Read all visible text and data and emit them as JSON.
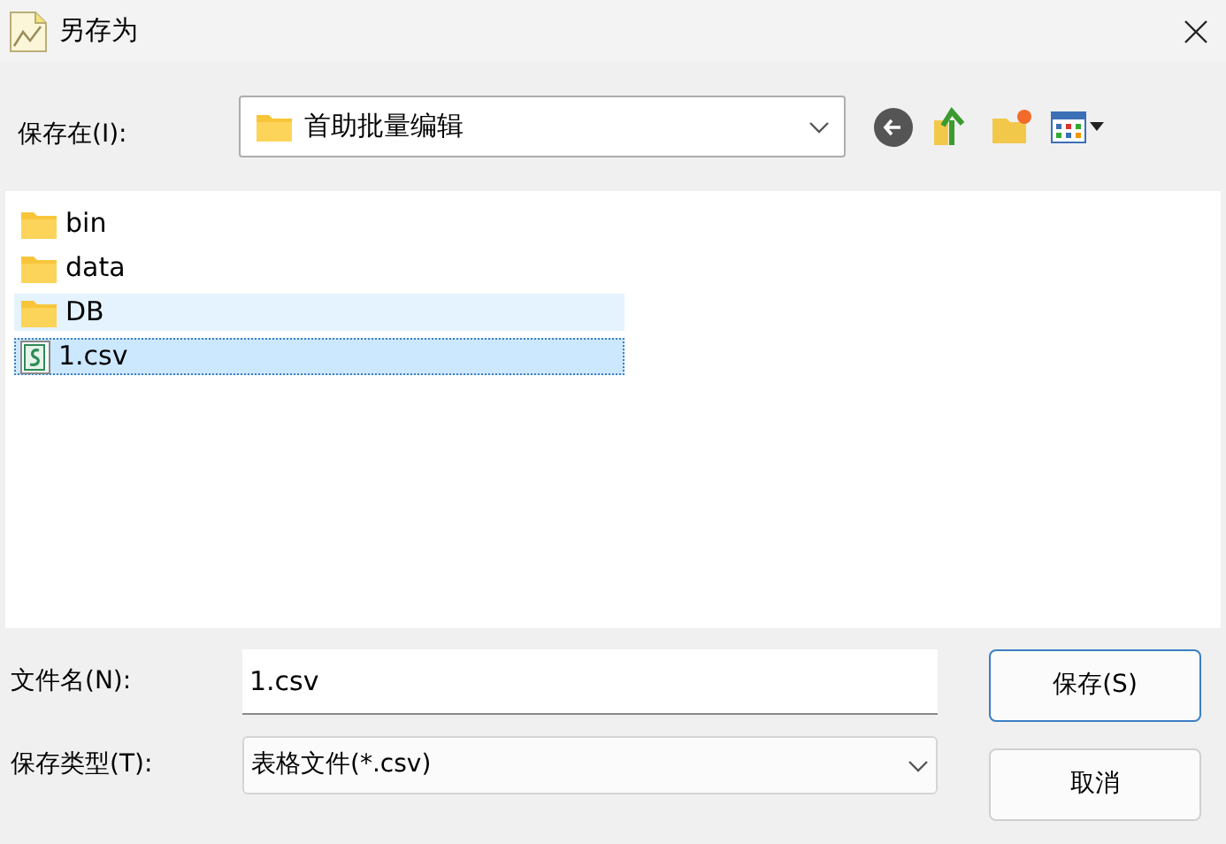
{
  "window": {
    "title": "另存为"
  },
  "location": {
    "label": "保存在(I):",
    "value": "首助批量编辑"
  },
  "files": [
    {
      "name": "bin",
      "kind": "folder",
      "selected": false,
      "hovered": false
    },
    {
      "name": "data",
      "kind": "folder",
      "selected": false,
      "hovered": false
    },
    {
      "name": "DB",
      "kind": "folder",
      "selected": false,
      "hovered": true
    },
    {
      "name": "1.csv",
      "kind": "csv",
      "selected": true,
      "hovered": false
    }
  ],
  "filename": {
    "label": "文件名(N):",
    "value": "1.csv"
  },
  "filetype": {
    "label": "保存类型(T):",
    "value": "表格文件(*.csv)"
  },
  "buttons": [
    {
      "label": "保存(S)",
      "kind": "primary"
    },
    {
      "label": "取消",
      "kind": "secondary"
    }
  ]
}
